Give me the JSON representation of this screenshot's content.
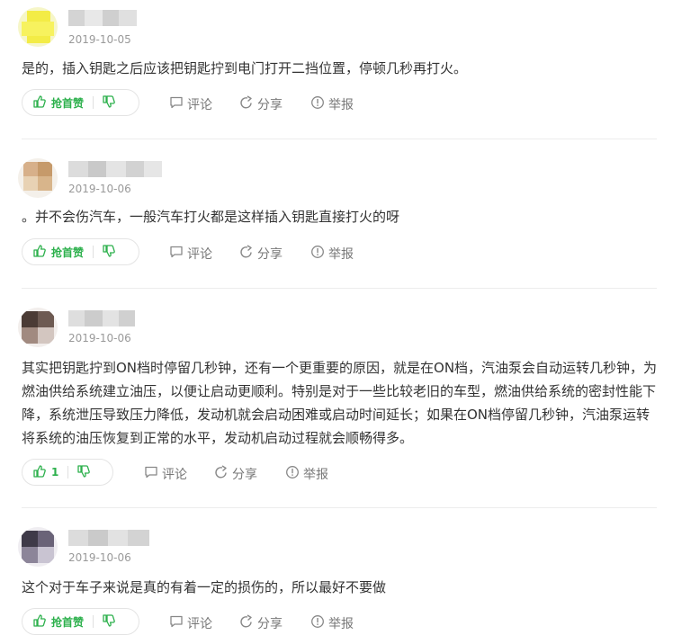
{
  "answers": [
    {
      "date": "2019-10-05",
      "content": "是的，插入钥匙之后应该把钥匙拧到电门打开二挡位置，停顿几秒再打火。",
      "upvote_label": "抢首赞"
    },
    {
      "date": "2019-10-06",
      "content": "。并不会伤汽车，一般汽车打火都是这样插入钥匙直接打火的呀",
      "upvote_label": "抢首赞"
    },
    {
      "date": "2019-10-06",
      "content": "其实把钥匙拧到ON档时停留几秒钟，还有一个更重要的原因，就是在ON档，汽油泵会自动运转几秒钟，为燃油供给系统建立油压，以便让启动更顺利。特别是对于一些比较老旧的车型，燃油供给系统的密封性能下降，系统泄压导致压力降低，发动机就会启动困难或启动时间延长；如果在ON档停留几秒钟，汽油泵运转将系统的油压恢复到正常的水平，发动机启动过程就会顺畅得多。",
      "upvote_label": "1"
    },
    {
      "date": "2019-10-06",
      "content": "这个对于车子来说是真的有着一定的损伤的，所以最好不要做",
      "upvote_label": "抢首赞"
    }
  ],
  "actions": {
    "comment": "评论",
    "share": "分享",
    "report": "举报"
  },
  "colors": {
    "accent_green": "#2cb04c",
    "text": "#333333",
    "muted": "#777777",
    "date": "#9a9a9a"
  },
  "icons": [
    "thumbs-up-icon",
    "thumbs-down-icon",
    "comment-icon",
    "share-icon",
    "report-icon"
  ]
}
